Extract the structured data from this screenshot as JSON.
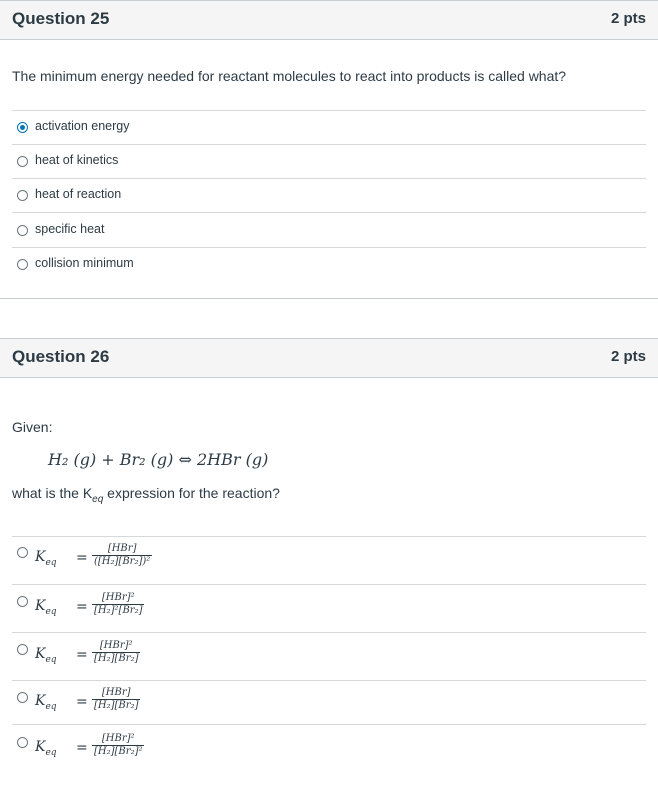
{
  "q25": {
    "title": "Question 25",
    "points": "2 pts",
    "text": "The minimum energy needed for reactant molecules to react into products is called what?",
    "answers": [
      "activation energy",
      "heat of kinetics",
      "heat of reaction",
      "specific heat",
      "collision minimum"
    ],
    "selected_index": 0
  },
  "q26": {
    "title": "Question 26",
    "points": "2 pts",
    "given": "Given:",
    "equation": "H₂ (g) + Br₂ (g) ⇔ 2HBr (g)",
    "prompt_before": "what is the K",
    "prompt_sub": "eq",
    "prompt_after": " expression for the reaction?",
    "keq_label": "K",
    "keq_sub": "eq",
    "answers": [
      {
        "num": "[HBr]",
        "den": "([H₂][Br₂])²"
      },
      {
        "num": "[HBr]²",
        "den": "[H₂]²[Br₂]"
      },
      {
        "num": "[HBr]²",
        "den": "[H₂][Br₂]"
      },
      {
        "num": "[HBr]",
        "den": "[H₂][Br₂]"
      },
      {
        "num": "[HBr]²",
        "den": "[H₂][Br₂]²"
      }
    ]
  }
}
